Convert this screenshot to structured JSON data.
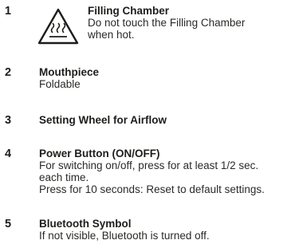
{
  "items": [
    {
      "number": "1",
      "title": "Filling Chamber",
      "lines": [
        "Do not touch the Filling Chamber",
        "when hot."
      ],
      "icon": "hot-surface-warning-icon"
    },
    {
      "number": "2",
      "title": "Mouthpiece",
      "lines": [
        "Foldable"
      ]
    },
    {
      "number": "3",
      "title": "Setting Wheel for Airflow",
      "lines": []
    },
    {
      "number": "4",
      "title": "Power Button (ON/OFF)",
      "lines": [
        "For switching on/off, press for at least 1/2 sec.",
        "each time.",
        "Press for 10 seconds: Reset to default settings."
      ]
    },
    {
      "number": "5",
      "title": "Bluetooth Symbol",
      "lines": [
        "If not visible, Bluetooth is turned off."
      ]
    }
  ]
}
